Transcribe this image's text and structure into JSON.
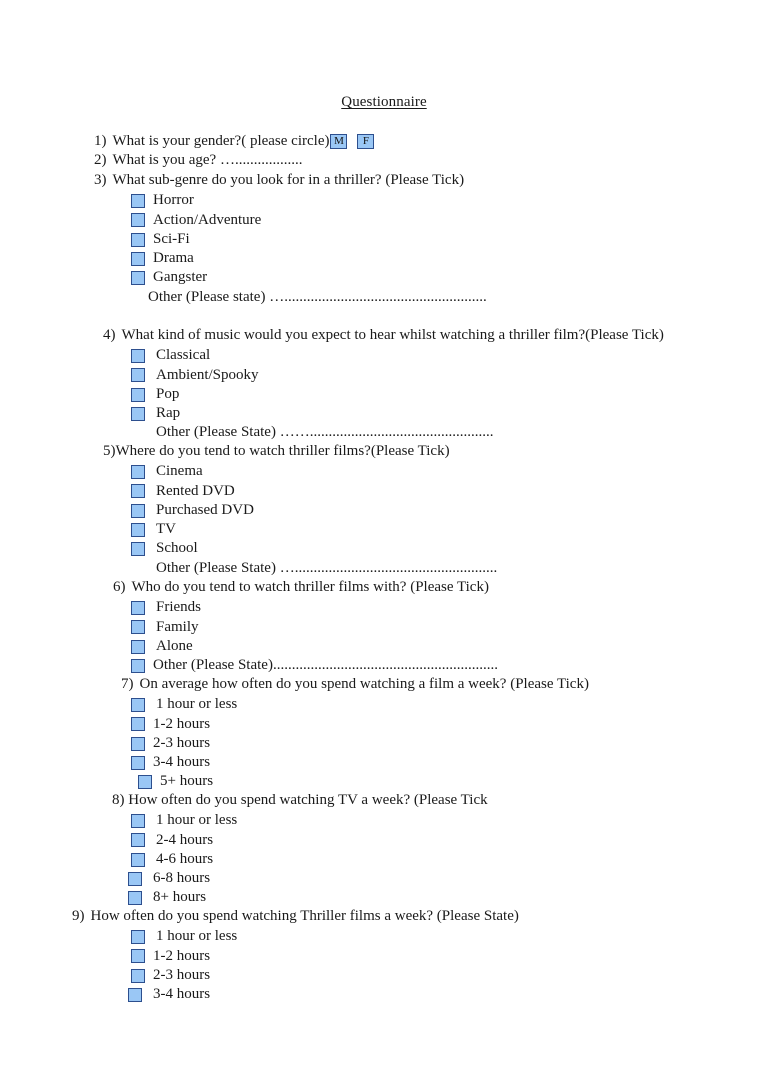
{
  "document": {
    "title": "Questionnaire"
  },
  "gender_options": [
    {
      "label": "M"
    },
    {
      "label": "F"
    }
  ],
  "questions": [
    {
      "number": "1)",
      "text": "What is your gender?( please circle)",
      "type": "circle-gender"
    },
    {
      "number": "2)",
      "text": "What is you age? …..................",
      "type": "text-line"
    },
    {
      "number": "3)",
      "text": "What sub-genre do you look for in a thriller? (Please Tick)",
      "type": "checkbox-list",
      "options": [
        {
          "label": "Horror"
        },
        {
          "label": "Action/Adventure"
        },
        {
          "label": "Sci-Fi"
        },
        {
          "label": "Drama"
        },
        {
          "label": "Gangster"
        }
      ],
      "other": {
        "label": "Other (Please state) …......................................................",
        "has_checkbox": false
      }
    },
    {
      "number": "4)",
      "text": "What kind of music would you expect to hear whilst watching a thriller film?(Please Tick)",
      "type": "checkbox-list",
      "options": [
        {
          "label": "Classical"
        },
        {
          "label": "Ambient/Spooky"
        },
        {
          "label": "Pop"
        },
        {
          "label": "Rap"
        }
      ],
      "other": {
        "label": "Other (Please State) …….................................................",
        "has_checkbox": false
      }
    },
    {
      "number": "5)",
      "text": "Where do you tend to watch thriller films?(Please Tick)",
      "type": "checkbox-list",
      "options": [
        {
          "label": "Cinema"
        },
        {
          "label": "Rented DVD"
        },
        {
          "label": "Purchased DVD"
        },
        {
          "label": "TV"
        },
        {
          "label": "School"
        }
      ],
      "other": {
        "label": "Other (Please State) …......................................................",
        "has_checkbox": false
      }
    },
    {
      "number": "6)",
      "text": "Who do you tend to watch thriller films with? (Please Tick)",
      "type": "checkbox-list",
      "options": [
        {
          "label": "Friends"
        },
        {
          "label": "Family"
        },
        {
          "label": "Alone"
        }
      ],
      "other": {
        "label": "Other (Please State)............................................................",
        "has_checkbox": true
      }
    },
    {
      "number": "7)",
      "text": "On average how often do you spend watching a film a week? (Please Tick)",
      "type": "checkbox-list",
      "options": [
        {
          "label": "1 hour or less"
        },
        {
          "label": "1-2 hours"
        },
        {
          "label": "2-3 hours"
        },
        {
          "label": "3-4 hours"
        },
        {
          "label": "5+ hours"
        }
      ]
    },
    {
      "number": "8)",
      "text": "How often do you spend watching TV a week? (Please Tick",
      "type": "checkbox-list",
      "options": [
        {
          "label": "1 hour or less"
        },
        {
          "label": "2-4 hours"
        },
        {
          "label": "4-6 hours"
        },
        {
          "label": "6-8 hours"
        },
        {
          "label": "8+ hours"
        }
      ]
    },
    {
      "number": "9)",
      "text": "How often do you spend watching Thriller films a week? (Please State)",
      "type": "checkbox-list",
      "options": [
        {
          "label": "1 hour or less"
        },
        {
          "label": "1-2 hours"
        },
        {
          "label": "2-3 hours"
        },
        {
          "label": "3-4 hours"
        }
      ]
    }
  ],
  "colors": {
    "checkbox_fill": "#9ac7f5",
    "checkbox_border": "#2d4f8e",
    "text": "#1a1a1a",
    "page_background": "#ffffff"
  }
}
